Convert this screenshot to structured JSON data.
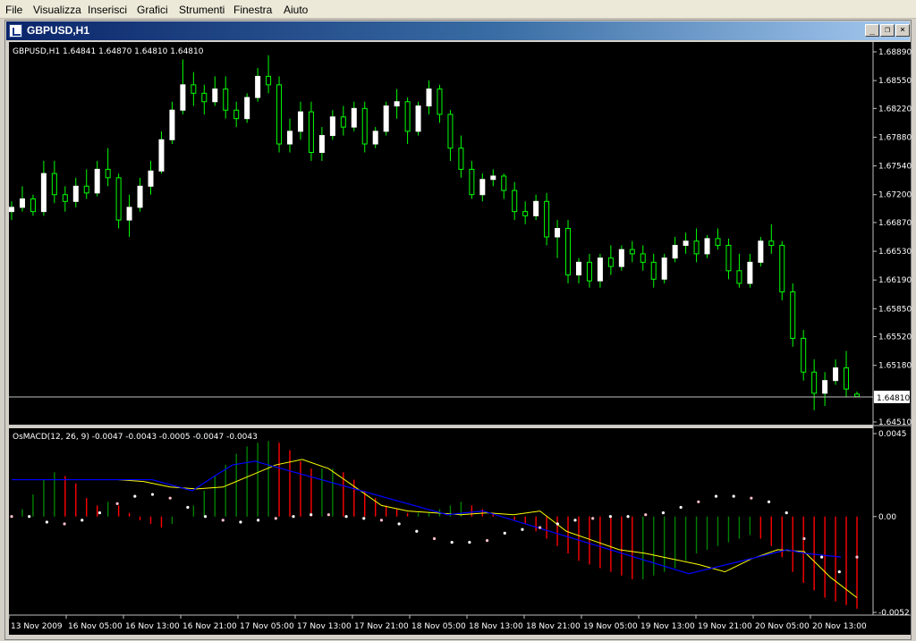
{
  "menu": {
    "items": [
      {
        "label": "File"
      },
      {
        "label": "Visualizza"
      },
      {
        "label": "Inserisci"
      },
      {
        "label": "Grafici"
      },
      {
        "label": "Strumenti"
      },
      {
        "label": "Finestra"
      },
      {
        "label": "Aiuto"
      }
    ]
  },
  "window": {
    "title": "GBPUSD,H1",
    "minimize_glyph": "_",
    "restore_glyph": "❐",
    "close_glyph": "×"
  },
  "main_chart": {
    "info": "GBPUSD,H1  1.64841 1.64870 1.64810 1.64810",
    "price_ticks": [
      "1.68890",
      "1.68550",
      "1.68220",
      "1.67880",
      "1.67540",
      "1.67200",
      "1.66870",
      "1.66530",
      "1.66190",
      "1.65850",
      "1.65520",
      "1.65180",
      "1.64510"
    ],
    "current_price": "1.64810"
  },
  "macd": {
    "info": "OsMACD(12, 26, 9) -0.0047 -0.0043 -0.0005 -0.0047 -0.0043",
    "ticks": [
      "0.0045",
      "0.00",
      "-0.0052"
    ]
  },
  "time_axis": {
    "labels": [
      "13 Nov 2009",
      "16 Nov 05:00",
      "16 Nov 13:00",
      "16 Nov 21:00",
      "17 Nov 05:00",
      "17 Nov 13:00",
      "17 Nov 21:00",
      "18 Nov 05:00",
      "18 Nov 13:00",
      "18 Nov 21:00",
      "19 Nov 05:00",
      "19 Nov 13:00",
      "19 Nov 21:00",
      "20 Nov 05:00",
      "20 Nov 13:00"
    ]
  },
  "colors": {
    "background": "#000000",
    "candle_up": "#ffffff",
    "candle_wick": "#00ff00",
    "grid_line": "#c0c0c0",
    "macd_up": "#008000",
    "macd_down": "#ff0000",
    "signal_line": "#ffff00",
    "blue_line": "#0000ff",
    "dots": "#ffffff",
    "pink_dots": "#ffc0cb"
  },
  "chart_data": {
    "type": "candlestick",
    "price_range": [
      1.6451,
      1.6889
    ],
    "candles": [
      [
        1.67,
        1.6712,
        1.669,
        1.6705
      ],
      [
        1.6705,
        1.673,
        1.67,
        1.6715
      ],
      [
        1.6715,
        1.672,
        1.6695,
        1.67
      ],
      [
        1.67,
        1.676,
        1.6695,
        1.6745
      ],
      [
        1.6745,
        1.676,
        1.671,
        1.672
      ],
      [
        1.672,
        1.673,
        1.67,
        1.6712
      ],
      [
        1.6712,
        1.674,
        1.6705,
        1.673
      ],
      [
        1.673,
        1.675,
        1.6715,
        1.6722
      ],
      [
        1.6722,
        1.676,
        1.6718,
        1.675
      ],
      [
        1.675,
        1.6775,
        1.673,
        1.674
      ],
      [
        1.674,
        1.6745,
        1.668,
        1.669
      ],
      [
        1.669,
        1.672,
        1.667,
        1.6705
      ],
      [
        1.6705,
        1.674,
        1.67,
        1.673
      ],
      [
        1.673,
        1.676,
        1.672,
        1.6748
      ],
      [
        1.6748,
        1.6795,
        1.6745,
        1.6785
      ],
      [
        1.6785,
        1.683,
        1.678,
        1.682
      ],
      [
        1.682,
        1.688,
        1.6815,
        1.685
      ],
      [
        1.685,
        1.6865,
        1.6825,
        1.684
      ],
      [
        1.684,
        1.685,
        1.6815,
        1.683
      ],
      [
        1.683,
        1.686,
        1.6825,
        1.6845
      ],
      [
        1.6845,
        1.686,
        1.681,
        1.682
      ],
      [
        1.682,
        1.683,
        1.68,
        1.681
      ],
      [
        1.681,
        1.684,
        1.6805,
        1.6835
      ],
      [
        1.6835,
        1.687,
        1.683,
        1.686
      ],
      [
        1.686,
        1.6885,
        1.684,
        1.685
      ],
      [
        1.685,
        1.686,
        1.677,
        1.678
      ],
      [
        1.678,
        1.681,
        1.677,
        1.6795
      ],
      [
        1.6795,
        1.683,
        1.6785,
        1.6818
      ],
      [
        1.6818,
        1.683,
        1.676,
        1.677
      ],
      [
        1.677,
        1.68,
        1.676,
        1.679
      ],
      [
        1.679,
        1.682,
        1.6785,
        1.6812
      ],
      [
        1.6812,
        1.6825,
        1.679,
        1.68
      ],
      [
        1.68,
        1.683,
        1.6795,
        1.6822
      ],
      [
        1.6822,
        1.683,
        1.677,
        1.678
      ],
      [
        1.678,
        1.68,
        1.6775,
        1.6795
      ],
      [
        1.6795,
        1.683,
        1.679,
        1.6825
      ],
      [
        1.6825,
        1.6845,
        1.681,
        1.683
      ],
      [
        1.683,
        1.6835,
        1.678,
        1.6795
      ],
      [
        1.6795,
        1.683,
        1.679,
        1.6825
      ],
      [
        1.6825,
        1.6855,
        1.6815,
        1.6845
      ],
      [
        1.6845,
        1.685,
        1.6805,
        1.6815
      ],
      [
        1.6815,
        1.682,
        1.676,
        1.6775
      ],
      [
        1.6775,
        1.679,
        1.674,
        1.675
      ],
      [
        1.675,
        1.676,
        1.6715,
        1.672
      ],
      [
        1.672,
        1.6745,
        1.6712,
        1.6738
      ],
      [
        1.6738,
        1.675,
        1.673,
        1.6742
      ],
      [
        1.6742,
        1.6745,
        1.6715,
        1.6725
      ],
      [
        1.6725,
        1.6735,
        1.669,
        1.67
      ],
      [
        1.67,
        1.6712,
        1.6685,
        1.6695
      ],
      [
        1.6695,
        1.672,
        1.669,
        1.6712
      ],
      [
        1.6712,
        1.6722,
        1.666,
        1.667
      ],
      [
        1.667,
        1.669,
        1.6645,
        1.668
      ],
      [
        1.668,
        1.669,
        1.6615,
        1.6625
      ],
      [
        1.6625,
        1.6645,
        1.6615,
        1.664
      ],
      [
        1.664,
        1.665,
        1.661,
        1.6618
      ],
      [
        1.6618,
        1.665,
        1.661,
        1.6645
      ],
      [
        1.6645,
        1.666,
        1.6625,
        1.6635
      ],
      [
        1.6635,
        1.666,
        1.663,
        1.6655
      ],
      [
        1.6655,
        1.6665,
        1.664,
        1.665
      ],
      [
        1.665,
        1.666,
        1.663,
        1.664
      ],
      [
        1.664,
        1.665,
        1.661,
        1.662
      ],
      [
        1.662,
        1.665,
        1.6615,
        1.6645
      ],
      [
        1.6645,
        1.667,
        1.664,
        1.666
      ],
      [
        1.666,
        1.6675,
        1.665,
        1.6665
      ],
      [
        1.6665,
        1.668,
        1.664,
        1.665
      ],
      [
        1.665,
        1.6672,
        1.6645,
        1.6668
      ],
      [
        1.6668,
        1.668,
        1.6655,
        1.666
      ],
      [
        1.666,
        1.6668,
        1.662,
        1.663
      ],
      [
        1.663,
        1.665,
        1.661,
        1.6615
      ],
      [
        1.6615,
        1.665,
        1.661,
        1.664
      ],
      [
        1.664,
        1.667,
        1.6635,
        1.6665
      ],
      [
        1.6665,
        1.6685,
        1.665,
        1.666
      ],
      [
        1.666,
        1.6665,
        1.6595,
        1.6605
      ],
      [
        1.6605,
        1.6615,
        1.654,
        1.655
      ],
      [
        1.655,
        1.656,
        1.65,
        1.651
      ],
      [
        1.651,
        1.6525,
        1.6465,
        1.6485
      ],
      [
        1.6485,
        1.651,
        1.647,
        1.65
      ],
      [
        1.65,
        1.6525,
        1.6495,
        1.6515
      ],
      [
        1.6515,
        1.6535,
        1.648,
        1.649
      ],
      [
        1.6484,
        1.6487,
        1.6481,
        1.6481
      ]
    ]
  },
  "macd_data": {
    "range": [
      -0.0052,
      0.0045
    ],
    "hist": [
      -0.0,
      0.0004,
      0.0012,
      0.002,
      0.0024,
      0.0022,
      0.0018,
      0.001,
      0.0006,
      0.0008,
      0.0006,
      0.0002,
      -0.0002,
      -0.0004,
      -0.0006,
      -0.0004,
      0.0,
      0.0006,
      0.0014,
      0.0022,
      0.0028,
      0.0034,
      0.0038,
      0.004,
      0.0041,
      0.004,
      0.0036,
      0.003,
      0.0026,
      0.0026,
      0.0026,
      0.0024,
      0.002,
      0.0014,
      0.001,
      0.0006,
      0.0004,
      0.0002,
      0.0002,
      0.0002,
      0.0004,
      0.0006,
      0.0008,
      0.0006,
      0.0004,
      0.0002,
      0.0,
      -0.0002,
      -0.0004,
      -0.0008,
      -0.0012,
      -0.0016,
      -0.002,
      -0.0024,
      -0.0026,
      -0.0028,
      -0.003,
      -0.0032,
      -0.0034,
      -0.0034,
      -0.0032,
      -0.003,
      -0.0028,
      -0.0024,
      -0.002,
      -0.0018,
      -0.0016,
      -0.0014,
      -0.0012,
      -0.001,
      -0.0012,
      -0.0016,
      -0.0022,
      -0.003,
      -0.0036,
      -0.004,
      -0.0044,
      -0.0046,
      -0.0048,
      -0.005
    ],
    "signal": [
      0.002,
      0.002,
      0.002,
      0.002,
      0.002,
      0.0019,
      0.0016,
      0.0015,
      0.0016,
      0.0022,
      0.0028,
      0.0031,
      0.0026,
      0.0016,
      0.0006,
      0.0003,
      0.0002,
      0.0001,
      0.0002,
      0.0001,
      0.0003,
      -0.0008,
      -0.0013,
      -0.0018,
      -0.002,
      -0.0023,
      -0.0026,
      -0.003,
      -0.0023,
      -0.0018,
      -0.0019,
      -0.0033,
      -0.0044
    ],
    "blue": [
      0.002,
      0.002,
      0.002,
      0.0014,
      0.0022,
      0.0028,
      0.003,
      0.0001,
      0.0003,
      -0.0031,
      -0.0024,
      -0.0018,
      -0.002,
      -0.0022
    ],
    "dots": [
      -0.0,
      -0.0,
      -0.0003,
      -0.0004,
      -0.0002,
      0.0002,
      0.0007,
      0.0011,
      0.0012,
      0.001,
      0.0005,
      0.0,
      -0.0002,
      -0.0003,
      -0.0002,
      -0.0001,
      -0.0,
      0.0001,
      0.0001,
      0.0,
      -0.0001,
      -0.0002,
      -0.0004,
      -0.0008,
      -0.0012,
      -0.0014,
      -0.0014,
      -0.0013,
      -0.0009,
      -0.0007,
      -0.0006,
      -0.0004,
      -0.0002,
      -0.0001,
      -0.0,
      0.0,
      0.0001,
      0.0002,
      0.0005,
      0.0008,
      0.0011,
      0.0011,
      0.001,
      0.0008,
      0.0002,
      -0.0012,
      -0.0022,
      -0.003,
      -0.0022
    ]
  }
}
